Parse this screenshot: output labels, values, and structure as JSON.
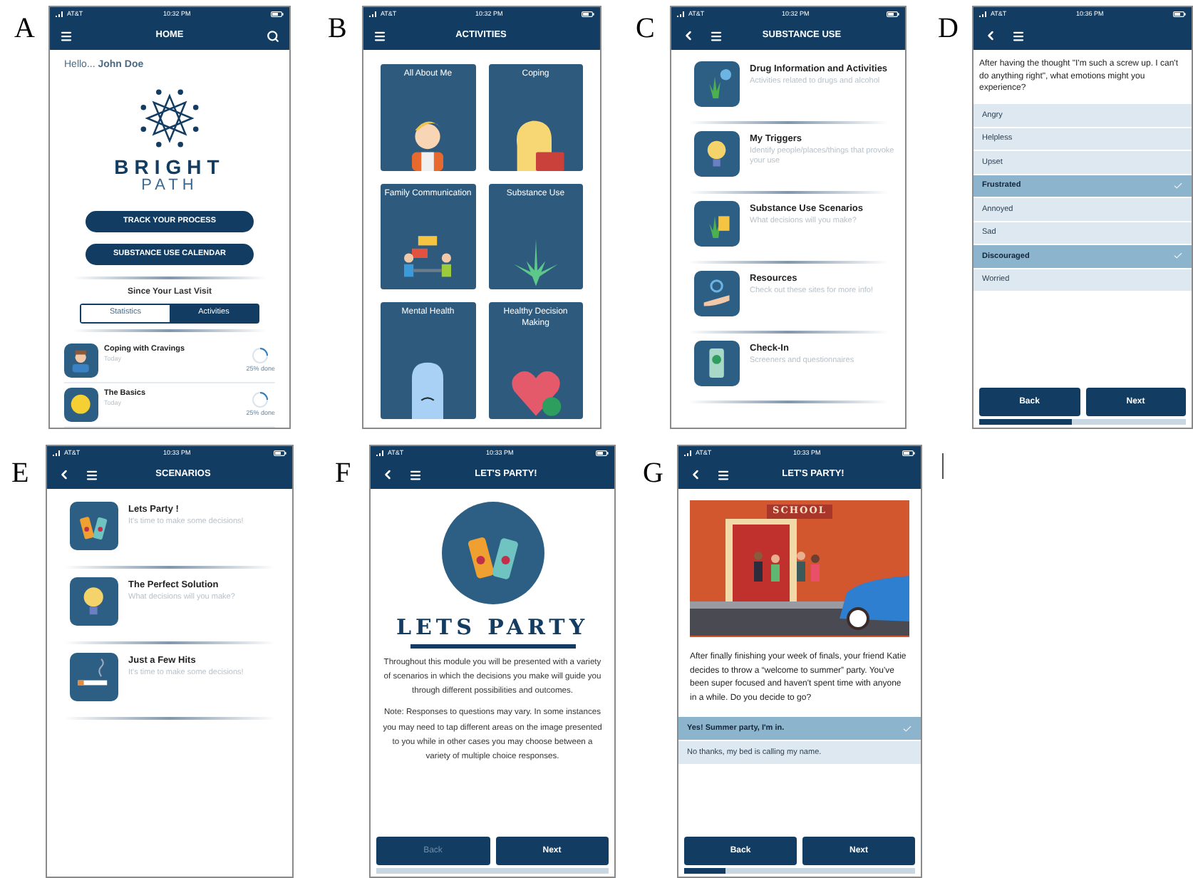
{
  "panels": [
    {
      "label": "A",
      "kind": "home",
      "status": {
        "carrier": "AT&T",
        "time": "10:32 PM"
      },
      "back": false,
      "search": true,
      "title": "HOME",
      "greeting": "Hello... **John Doe**",
      "brand_top": "BRIGHT",
      "brand_bottom": "PATH",
      "buttons": [
        "TRACK YOUR PROCESS",
        "SUBSTANCE USE CALENDAR"
      ],
      "section": "Since Your Last Visit",
      "tabs": [
        {
          "label": "Statistics",
          "selected": false
        },
        {
          "label": "Activities",
          "selected": true
        }
      ],
      "items": [
        {
          "title": "Coping with Cravings",
          "subtitle": "Today",
          "progress": "25% done",
          "level": 0.25
        },
        {
          "title": "The Basics",
          "subtitle": "Today",
          "progress": "25% done",
          "level": 0.25
        }
      ]
    },
    {
      "label": "B",
      "kind": "activities",
      "status": {
        "carrier": "AT&T",
        "time": "10:32 PM"
      },
      "back": false,
      "title": "ACTIVITIES",
      "tiles": [
        "All About Me",
        "Coping",
        "Family Communication",
        "Substance Use",
        "Mental Health",
        "Healthy Decision Making"
      ]
    },
    {
      "label": "C",
      "kind": "menu",
      "status": {
        "carrier": "AT&T",
        "time": "10:32 PM"
      },
      "back": true,
      "title": "SUBSTANCE USE",
      "items": [
        {
          "title": "Drug Information and Activities",
          "subtitle": "Activities related to drugs and alcohol"
        },
        {
          "title": "My Triggers",
          "subtitle": "Identify people/places/things that provoke your use"
        },
        {
          "title": "Substance Use Scenarios",
          "subtitle": "What decisions will you make?"
        },
        {
          "title": "Resources",
          "subtitle": "Check out these sites for more info!"
        },
        {
          "title": "Check-In",
          "subtitle": "Screeners and questionnaires"
        }
      ]
    },
    {
      "label": "D",
      "kind": "question",
      "status": {
        "carrier": "AT&T",
        "time": "10:36 PM"
      },
      "back": true,
      "question": "After having the thought \"I'm such a screw up. I can't do anything right\", what emotions might you experience?",
      "options": [
        {
          "label": "Angry",
          "selected": false
        },
        {
          "label": "Helpless",
          "selected": false
        },
        {
          "label": "Upset",
          "selected": false
        },
        {
          "label": "Frustrated",
          "selected": true
        },
        {
          "label": "Annoyed",
          "selected": false
        },
        {
          "label": "Sad",
          "selected": false
        },
        {
          "label": "Discouraged",
          "selected": true
        },
        {
          "label": "Worried",
          "selected": false
        }
      ],
      "buttons": [
        {
          "label": "Back",
          "disabled": false
        },
        {
          "label": "Next",
          "disabled": false
        }
      ],
      "level": 0.45
    },
    {
      "label": "E",
      "kind": "menu",
      "status": {
        "carrier": "AT&T",
        "time": "10:33 PM"
      },
      "back": true,
      "title": "SCENARIOS",
      "items": [
        {
          "title": "Lets Party !",
          "subtitle": "It's time to make some decisions!"
        },
        {
          "title": "The Perfect Solution",
          "subtitle": "What decisions will you make?"
        },
        {
          "title": "Just a Few Hits",
          "subtitle": "It's time to make some decisions!"
        }
      ]
    },
    {
      "label": "F",
      "kind": "intro",
      "status": {
        "carrier": "AT&T",
        "time": "10:33 PM"
      },
      "back": true,
      "title": "LET'S PARTY!",
      "heading": "LETS PARTY",
      "paragraphs": [
        "Throughout this module you will be presented with a variety of scenarios in which the decisions you make will guide you through different possibilities and outcomes.",
        "Note: Responses to questions may vary. In some instances you may need to tap different areas on the image presented to you while in other cases you may choose between a variety of multiple choice responses."
      ],
      "buttons": [
        {
          "label": "Back",
          "disabled": true
        },
        {
          "label": "Next",
          "disabled": false
        }
      ],
      "level": 0
    },
    {
      "label": "G",
      "kind": "scenario",
      "status": {
        "carrier": "AT&T",
        "time": "10:33 PM"
      },
      "back": true,
      "title": "LET'S PARTY!",
      "sign": "SCHOOL",
      "story": "After finally finishing your week of finals, your friend Katie decides to throw a “welcome to summer” party. You've been super focused and haven't spent time with anyone in a while. Do you decide to go?",
      "options": [
        {
          "label": "Yes! Summer party, I'm in.",
          "selected": true
        },
        {
          "label": "No thanks, my bed is calling my name.",
          "selected": false
        }
      ],
      "buttons": [
        {
          "label": "Back",
          "disabled": false
        },
        {
          "label": "Next",
          "disabled": false
        }
      ],
      "level": 0.18
    }
  ]
}
